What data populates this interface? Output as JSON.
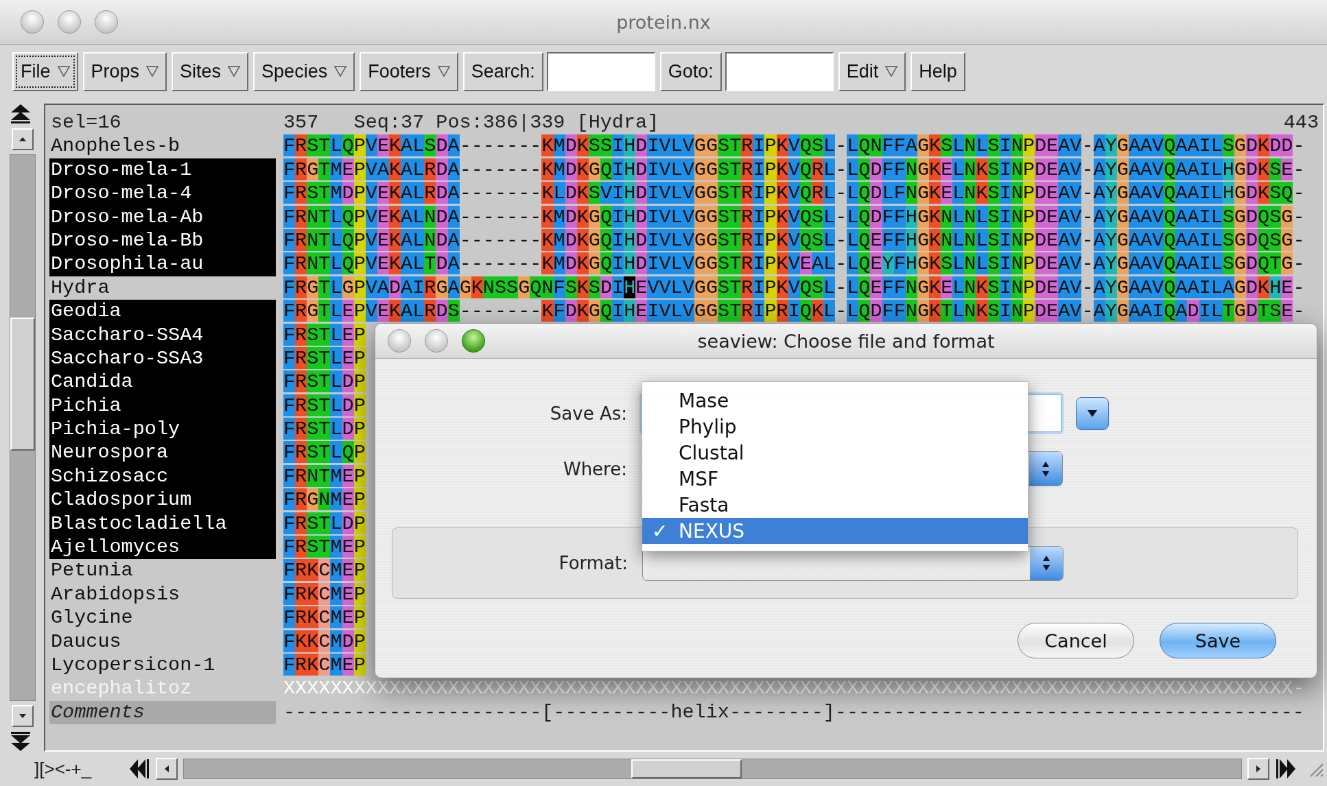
{
  "window": {
    "title": "protein.nx"
  },
  "toolbar": [
    {
      "kind": "menu",
      "label": "File",
      "focused": true
    },
    {
      "kind": "menu",
      "label": "Props",
      "focused": false
    },
    {
      "kind": "menu",
      "label": "Sites",
      "focused": false
    },
    {
      "kind": "menu",
      "label": "Species",
      "focused": false
    },
    {
      "kind": "menu",
      "label": "Footers",
      "focused": false
    },
    {
      "kind": "field",
      "label": "Search:",
      "focused": false
    },
    {
      "kind": "field",
      "label": "Goto:",
      "focused": false
    },
    {
      "kind": "menu",
      "label": "Edit",
      "focused": false
    },
    {
      "kind": "button",
      "label": "Help",
      "focused": false
    }
  ],
  "header": {
    "selection": "sel=16",
    "start": "357",
    "status": "Seq:37 Pos:386|339 [Hydra]",
    "end": "443"
  },
  "rows": [
    {
      "name": "Anopheles-b",
      "selected": false,
      "dimmed": false,
      "sequence": "FRSTLQPVEKALSDA-------KMDKSSIHDIVLVGGSTRIPKVQSL-LQNFFAGKSLNLSINPDEAV-AYGAAVQAAILSGDKDD-"
    },
    {
      "name": "Droso-mela-1",
      "selected": true,
      "dimmed": false,
      "sequence": "FRGTMEPVAKALRDA-------KMDKGQIHDIVLVGGSTRIPKVQRL-LQDFFNGKELNKSINPDEAV-AYGAAVQAAILHGDKSE-"
    },
    {
      "name": "Droso-mela-4",
      "selected": true,
      "dimmed": false,
      "sequence": "FRSTMDPVEKALRDA-------KLDKSVIHDIVLVGGSTRIPKVQRL-LQDLFNGKELNKSINPDEAV-AYGAAVQAAILHGDKSQ-"
    },
    {
      "name": "Droso-mela-Ab",
      "selected": true,
      "dimmed": false,
      "sequence": "FRNTLQPVEKALNDA-------KMDKGQIHDIVLVGGSTRIPKVQSL-LQDFFHGKNLNLSINPDEAV-AYGAAVQAAILSGDQSG-"
    },
    {
      "name": "Droso-mela-Bb",
      "selected": true,
      "dimmed": false,
      "sequence": "FRNTLQPVEKALNDA-------KMDKGQIHDIVLVGGSTRIPKVQSL-LQEFFHGKNLNLSINPDEAV-AYGAAVQAAILSGDQSG-"
    },
    {
      "name": "Drosophila-au",
      "selected": true,
      "dimmed": false,
      "sequence": "FRNTLQPVEKALTDA-------KMDKGQIHDIVLVGGSTRIPKVEAL-LQEYFHGKSLNLSINPDEAV-AYGAAVQAAILSGDQTG-"
    },
    {
      "name": "Hydra",
      "selected": false,
      "dimmed": false,
      "sequence": "FRGTLGPVADAIRGAGKNSSGQNFSKSDI",
      "cursor_residue": "H",
      "sequence_after": "EVVLVGGSTRIPKVQSL-LQEFFNGKELNKSINPDEAV-AYGAAVQAAILAGDKHE-"
    },
    {
      "name": "Geodia",
      "selected": true,
      "dimmed": false,
      "sequence": "FRGTLEPVEKALRDS-------KFDKGQIHEIVLVGGSTRIPRIQKL-LQDFFNGKTLNKSINPDEAV-AYGAAIQADILTGDTSE-"
    },
    {
      "name": "Saccharo-SSA4",
      "selected": true,
      "dimmed": false,
      "sequence": "FRSTLEP"
    },
    {
      "name": "Saccharo-SSA3",
      "selected": true,
      "dimmed": false,
      "sequence": "FRSTLEP"
    },
    {
      "name": "Candida",
      "selected": true,
      "dimmed": false,
      "sequence": "FRSTLDP"
    },
    {
      "name": "Pichia",
      "selected": true,
      "dimmed": false,
      "sequence": "FRSTLDP"
    },
    {
      "name": "Pichia-poly",
      "selected": true,
      "dimmed": false,
      "sequence": "FRSTLDP"
    },
    {
      "name": "Neurospora",
      "selected": true,
      "dimmed": false,
      "sequence": "FRSTLQP"
    },
    {
      "name": "Schizosacc",
      "selected": true,
      "dimmed": false,
      "sequence": "FRNTMEP"
    },
    {
      "name": "Cladosporium",
      "selected": true,
      "dimmed": false,
      "sequence": "FRGNMEP"
    },
    {
      "name": "Blastocladiella",
      "selected": true,
      "dimmed": false,
      "sequence": "FRSTLDP"
    },
    {
      "name": "Ajellomyces",
      "selected": true,
      "dimmed": false,
      "sequence": "FRSTMEP"
    },
    {
      "name": "Petunia",
      "selected": false,
      "dimmed": false,
      "sequence": "FRKCMEP"
    },
    {
      "name": "Arabidopsis",
      "selected": false,
      "dimmed": false,
      "sequence": "FRKCMEP"
    },
    {
      "name": "Glycine",
      "selected": false,
      "dimmed": false,
      "sequence": "FRKCMEP"
    },
    {
      "name": "Daucus",
      "selected": false,
      "dimmed": false,
      "sequence": "FKKCMDP"
    },
    {
      "name": "Lycopersicon-1",
      "selected": false,
      "dimmed": false,
      "sequence": "FRKCMEP"
    },
    {
      "name": "encephalitoz",
      "selected": false,
      "dimmed": true,
      "sequence": "XXXXXXXXXXXXXXXXXXXXXXXXXXXXXXXXXXXXXXXXXXXXXXXXXXXXXXXXXXXXXXXXXXXXXXXXXXXXXXXXXXXXXX-"
    }
  ],
  "comments": {
    "label": "Comments",
    "line": "----------------------[----------helix--------]----------------------------------------"
  },
  "bottom_bar": {
    "label": "][><-+_"
  },
  "dialog": {
    "title": "seaview: Choose file and format",
    "save_as": {
      "label": "Save As:"
    },
    "where": {
      "label": "Where:"
    },
    "format": {
      "label": "Format:",
      "check_mark": "✓",
      "options": [
        {
          "label": "Mase",
          "selected": false
        },
        {
          "label": "Phylip",
          "selected": false
        },
        {
          "label": "Clustal",
          "selected": false
        },
        {
          "label": "MSF",
          "selected": false
        },
        {
          "label": "Fasta",
          "selected": false
        },
        {
          "label": "NEXUS",
          "selected": true
        }
      ]
    },
    "buttons": [
      {
        "label": "Cancel",
        "default": false
      },
      {
        "label": "Save",
        "default": true
      }
    ]
  }
}
